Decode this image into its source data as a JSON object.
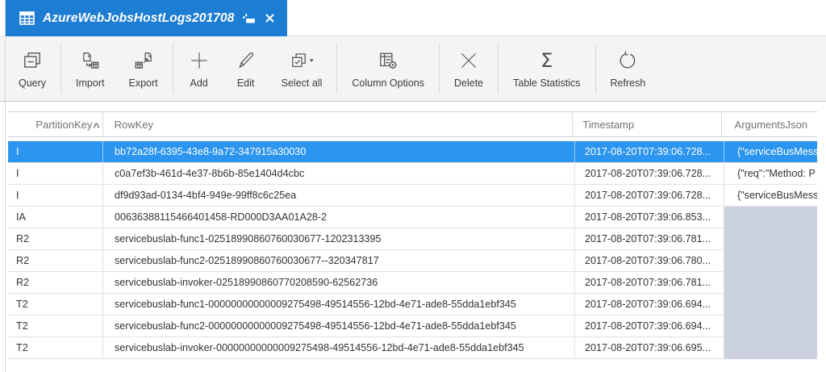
{
  "tab": {
    "title": "AzureWebJobsHostLogs201708",
    "icons": [
      "table-grid-icon",
      "pin-tab-icon",
      "close-icon"
    ],
    "color": "#1d7dd3"
  },
  "toolbar": {
    "items": [
      {
        "label": "Query",
        "icon": "query-icon"
      },
      {
        "label": "Import",
        "icon": "import-icon"
      },
      {
        "label": "Export",
        "icon": "export-icon"
      },
      {
        "label": "Add",
        "icon": "plus-icon"
      },
      {
        "label": "Edit",
        "icon": "pencil-icon"
      },
      {
        "label": "Select all",
        "icon": "select-all-icon"
      },
      {
        "label": "Column Options",
        "icon": "column-options-icon"
      },
      {
        "label": "Delete",
        "icon": "delete-x-icon"
      },
      {
        "label": "Table Statistics",
        "icon": "sigma-icon"
      },
      {
        "label": "Refresh",
        "icon": "refresh-icon"
      }
    ]
  },
  "table": {
    "columns": [
      {
        "label": "PartitionKey",
        "sort": "asc",
        "sort_glyph": "^"
      },
      {
        "label": "RowKey"
      },
      {
        "label": "Timestamp"
      },
      {
        "label": "ArgumentsJson"
      }
    ],
    "selected_row_index": 0,
    "selected_row_color": "#2c95ef",
    "empty_cell_color": "#cbd1de",
    "rows": [
      {
        "partitionKey": "I",
        "rowKey": "bb72a28f-6395-43e8-9a72-347915a30030",
        "timestamp": "2017-08-20T07:39:06.728...",
        "argumentsJson": "{\"serviceBusMessa"
      },
      {
        "partitionKey": "I",
        "rowKey": "c0a7ef3b-461d-4e37-8b6b-85e1404d4cbc",
        "timestamp": "2017-08-20T07:39:06.728...",
        "argumentsJson": "{\"req\":\"Method: P"
      },
      {
        "partitionKey": "I",
        "rowKey": "df9d93ad-0134-4bf4-949e-99ff8c6c25ea",
        "timestamp": "2017-08-20T07:39:06.728...",
        "argumentsJson": "{\"serviceBusMessa"
      },
      {
        "partitionKey": "IA",
        "rowKey": "00636388115466401458-RD000D3AA01A28-2",
        "timestamp": "2017-08-20T07:39:06.853...",
        "argumentsJson": ""
      },
      {
        "partitionKey": "R2",
        "rowKey": "servicebuslab-func1-02518990860760030677-1202313395",
        "timestamp": "2017-08-20T07:39:06.781...",
        "argumentsJson": ""
      },
      {
        "partitionKey": "R2",
        "rowKey": "servicebuslab-func2-02518990860760030677--320347817",
        "timestamp": "2017-08-20T07:39:06.780...",
        "argumentsJson": ""
      },
      {
        "partitionKey": "R2",
        "rowKey": "servicebuslab-invoker-02518990860770208590-62562736",
        "timestamp": "2017-08-20T07:39:06.781...",
        "argumentsJson": ""
      },
      {
        "partitionKey": "T2",
        "rowKey": "servicebuslab-func1-00000000000009275498-49514556-12bd-4e71-ade8-55dda1ebf345",
        "timestamp": "2017-08-20T07:39:06.694...",
        "argumentsJson": ""
      },
      {
        "partitionKey": "T2",
        "rowKey": "servicebuslab-func2-00000000000009275498-49514556-12bd-4e71-ade8-55dda1ebf345",
        "timestamp": "2017-08-20T07:39:06.694...",
        "argumentsJson": ""
      },
      {
        "partitionKey": "T2",
        "rowKey": "servicebuslab-invoker-00000000000009275498-49514556-12bd-4e71-ade8-55dda1ebf345",
        "timestamp": "2017-08-20T07:39:06.695...",
        "argumentsJson": ""
      }
    ]
  }
}
